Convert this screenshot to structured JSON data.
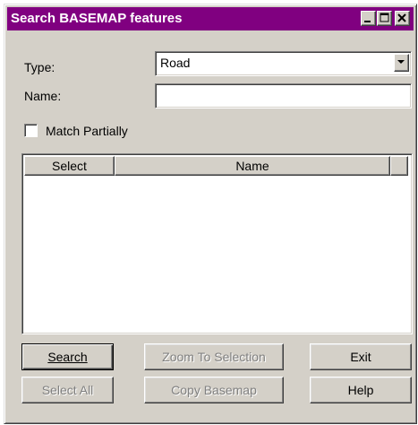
{
  "window": {
    "title": "Search BASEMAP features"
  },
  "titlebar_buttons": {
    "minimize_icon": "minimize-icon",
    "maximize_icon": "maximize-icon",
    "close_icon": "close-icon"
  },
  "form": {
    "type_label": "Type:",
    "type_value": "Road",
    "name_label": "Name:",
    "name_value": "",
    "match_partially_label": "Match Partially",
    "match_partially_checked": false
  },
  "results_table": {
    "columns": [
      "Select",
      "Name"
    ],
    "rows": []
  },
  "buttons": {
    "search": "Search",
    "zoom_to_selection": "Zoom To Selection",
    "exit": "Exit",
    "select_all": "Select All",
    "copy_basemap": "Copy Basemap",
    "help": "Help"
  },
  "colors": {
    "titlebar": "#800080",
    "face": "#d4d0c8",
    "disabled_text": "#808080"
  }
}
